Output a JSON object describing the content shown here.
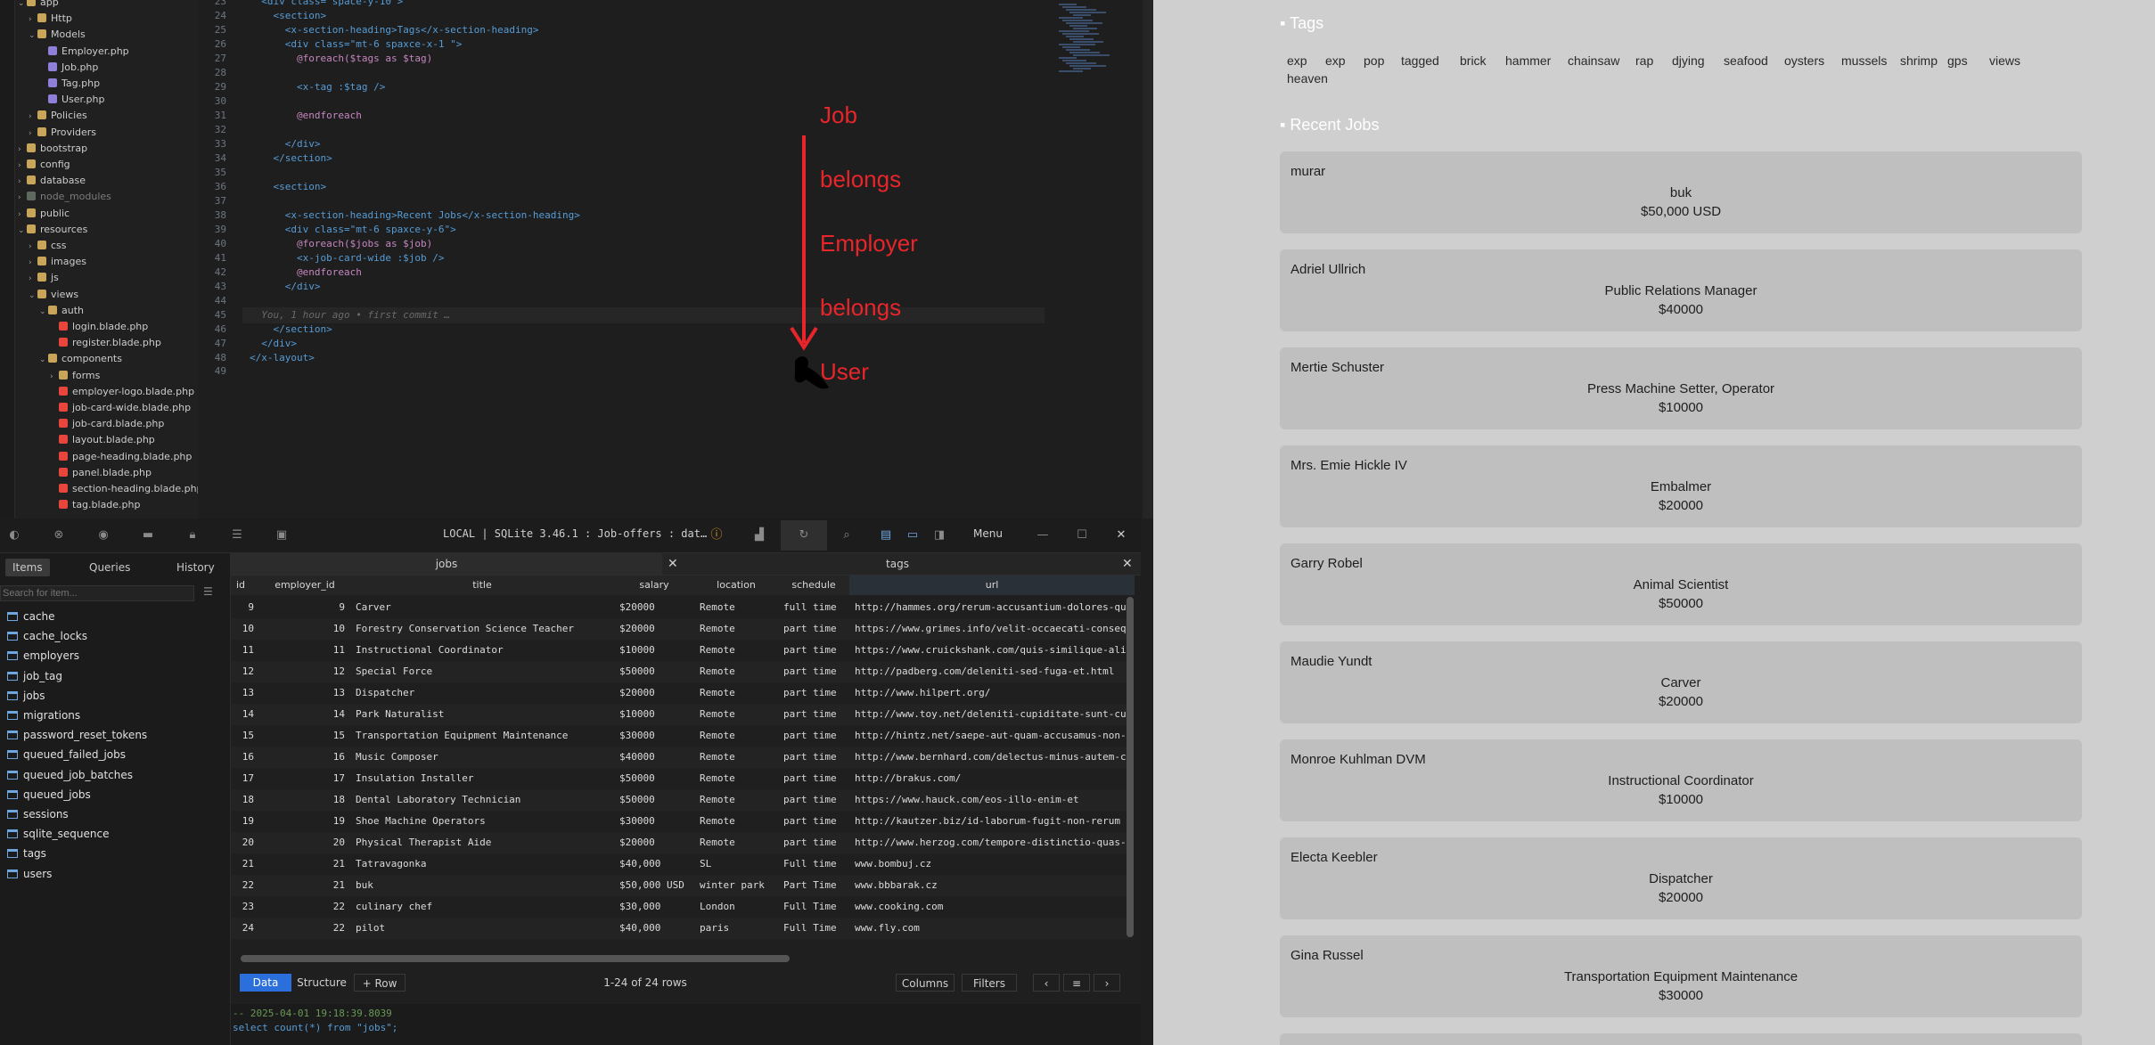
{
  "explorer": {
    "items": [
      {
        "label": "app",
        "depth": 1,
        "kind": "folder-open"
      },
      {
        "label": "Http",
        "depth": 2,
        "kind": "folder"
      },
      {
        "label": "Models",
        "depth": 2,
        "kind": "folder-open"
      },
      {
        "label": "Employer.php",
        "depth": 3,
        "kind": "php"
      },
      {
        "label": "Job.php",
        "depth": 3,
        "kind": "php"
      },
      {
        "label": "Tag.php",
        "depth": 3,
        "kind": "php"
      },
      {
        "label": "User.php",
        "depth": 3,
        "kind": "php"
      },
      {
        "label": "Policies",
        "depth": 2,
        "kind": "folder"
      },
      {
        "label": "Providers",
        "depth": 2,
        "kind": "folder"
      },
      {
        "label": "bootstrap",
        "depth": 1,
        "kind": "folder"
      },
      {
        "label": "config",
        "depth": 1,
        "kind": "folder"
      },
      {
        "label": "database",
        "depth": 1,
        "kind": "folder"
      },
      {
        "label": "node_modules",
        "depth": 1,
        "kind": "folder-muted"
      },
      {
        "label": "public",
        "depth": 1,
        "kind": "folder"
      },
      {
        "label": "resources",
        "depth": 1,
        "kind": "folder-open"
      },
      {
        "label": "css",
        "depth": 2,
        "kind": "folder"
      },
      {
        "label": "images",
        "depth": 2,
        "kind": "folder"
      },
      {
        "label": "js",
        "depth": 2,
        "kind": "folder"
      },
      {
        "label": "views",
        "depth": 2,
        "kind": "folder-open"
      },
      {
        "label": "auth",
        "depth": 3,
        "kind": "folder-open"
      },
      {
        "label": "login.blade.php",
        "depth": 4,
        "kind": "blade"
      },
      {
        "label": "register.blade.php",
        "depth": 4,
        "kind": "blade"
      },
      {
        "label": "components",
        "depth": 3,
        "kind": "folder-open"
      },
      {
        "label": "forms",
        "depth": 4,
        "kind": "folder"
      },
      {
        "label": "employer-logo.blade.php",
        "depth": 4,
        "kind": "blade"
      },
      {
        "label": "job-card-wide.blade.php",
        "depth": 4,
        "kind": "blade"
      },
      {
        "label": "job-card.blade.php",
        "depth": 4,
        "kind": "blade"
      },
      {
        "label": "layout.blade.php",
        "depth": 4,
        "kind": "blade"
      },
      {
        "label": "page-heading.blade.php",
        "depth": 4,
        "kind": "blade"
      },
      {
        "label": "panel.blade.php",
        "depth": 4,
        "kind": "blade"
      },
      {
        "label": "section-heading.blade.php",
        "depth": 4,
        "kind": "blade"
      },
      {
        "label": "tag.blade.php",
        "depth": 4,
        "kind": "blade"
      }
    ]
  },
  "editor": {
    "lines": [
      {
        "n": "23",
        "code": "  <div class=\"space-y-10\">"
      },
      {
        "n": "24",
        "code": "    <section>"
      },
      {
        "n": "25",
        "code": "      <x-section-heading>Tags</x-section-heading>"
      },
      {
        "n": "26",
        "code": "      <div class=\"mt-6 spaxce-x-1 \">"
      },
      {
        "n": "27",
        "code": "        @foreach($tags as $tag)"
      },
      {
        "n": "28",
        "code": ""
      },
      {
        "n": "29",
        "code": "        <x-tag :$tag />"
      },
      {
        "n": "30",
        "code": ""
      },
      {
        "n": "31",
        "code": "        @endforeach"
      },
      {
        "n": "32",
        "code": ""
      },
      {
        "n": "33",
        "code": "      </div>"
      },
      {
        "n": "34",
        "code": "    </section>"
      },
      {
        "n": "35",
        "code": ""
      },
      {
        "n": "36",
        "code": "    <section>"
      },
      {
        "n": "37",
        "code": ""
      },
      {
        "n": "38",
        "code": "      <x-section-heading>Recent Jobs</x-section-heading>"
      },
      {
        "n": "39",
        "code": "      <div class=\"mt-6 spaxce-y-6\">"
      },
      {
        "n": "40",
        "code": "        @foreach($jobs as $job)"
      },
      {
        "n": "41",
        "code": "        <x-job-card-wide :$job />"
      },
      {
        "n": "42",
        "code": "        @endforeach"
      },
      {
        "n": "43",
        "code": "      </div>"
      },
      {
        "n": "44",
        "code": ""
      },
      {
        "n": "45",
        "code": "  You, 1 hour ago • first commit …"
      },
      {
        "n": "46",
        "code": "    </section>"
      },
      {
        "n": "47",
        "code": "  </div>"
      },
      {
        "n": "48",
        "code": "</x-layout>"
      },
      {
        "n": "49",
        "code": ""
      }
    ]
  },
  "annotation": {
    "words": [
      "Job",
      "belongs",
      "Employer",
      "belongs",
      "User"
    ],
    "color": "#e8252a"
  },
  "db": {
    "connection": "LOCAL | SQLite 3.46.1 : Job-offers : dat…",
    "menu_label": "Menu",
    "sidebar_tabs": [
      "Items",
      "Queries",
      "History"
    ],
    "search_placeholder": "Search for item...",
    "tables": [
      "cache",
      "cache_locks",
      "employers",
      "job_tag",
      "jobs",
      "migrations",
      "password_reset_tokens",
      "queued_failed_jobs",
      "queued_job_batches",
      "queued_jobs",
      "sessions",
      "sqlite_sequence",
      "tags",
      "users"
    ],
    "open_tabs": [
      "jobs",
      "tags"
    ],
    "columns": [
      "id",
      "employer_id",
      "title",
      "salary",
      "location",
      "schedule",
      "url"
    ],
    "rows": [
      [
        "9",
        "9",
        "Carver",
        "$20000",
        "Remote",
        "full time",
        "http://hammes.org/rerum-accusantium-dolores-qu"
      ],
      [
        "10",
        "10",
        "Forestry Conservation Science Teacher",
        "$20000",
        "Remote",
        "part time",
        "https://www.grimes.info/velit-occaecati-conseq"
      ],
      [
        "11",
        "11",
        "Instructional Coordinator",
        "$10000",
        "Remote",
        "part time",
        "https://www.cruickshank.com/quis-similique-ali"
      ],
      [
        "12",
        "12",
        "Special Force",
        "$50000",
        "Remote",
        "part time",
        "http://padberg.com/deleniti-sed-fuga-et.html"
      ],
      [
        "13",
        "13",
        "Dispatcher",
        "$20000",
        "Remote",
        "part time",
        "http://www.hilpert.org/"
      ],
      [
        "14",
        "14",
        "Park Naturalist",
        "$10000",
        "Remote",
        "part time",
        "http://www.toy.net/deleniti-cupiditate-sunt-cu"
      ],
      [
        "15",
        "15",
        "Transportation Equipment Maintenance",
        "$30000",
        "Remote",
        "part time",
        "http://hintz.net/saepe-aut-quam-accusamus-non-"
      ],
      [
        "16",
        "16",
        "Music Composer",
        "$40000",
        "Remote",
        "part time",
        "http://www.bernhard.com/delectus-minus-autem-c"
      ],
      [
        "17",
        "17",
        "Insulation Installer",
        "$50000",
        "Remote",
        "part time",
        "http://brakus.com/"
      ],
      [
        "18",
        "18",
        "Dental Laboratory Technician",
        "$50000",
        "Remote",
        "part time",
        "https://www.hauck.com/eos-illo-enim-et"
      ],
      [
        "19",
        "19",
        "Shoe Machine Operators",
        "$30000",
        "Remote",
        "part time",
        "http://kautzer.biz/id-laborum-fugit-non-rerum"
      ],
      [
        "20",
        "20",
        "Physical Therapist Aide",
        "$20000",
        "Remote",
        "part time",
        "http://www.herzog.com/tempore-distinctio-quas-"
      ],
      [
        "21",
        "21",
        "Tatravagonka",
        "$40,000",
        "SL",
        "Full time",
        "www.bombuj.cz"
      ],
      [
        "22",
        "21",
        "buk",
        "$50,000 USD",
        "winter park",
        "Part Time",
        "www.bbbarak.cz"
      ],
      [
        "23",
        "22",
        "culinary chef",
        "$30,000",
        "London",
        "Full Time",
        "www.cooking.com"
      ],
      [
        "24",
        "22",
        "pilot",
        "$40,000",
        "paris",
        "Full Time",
        "www.fly.com"
      ]
    ],
    "bottom_tabs": [
      "Data",
      "Structure",
      "+ Row"
    ],
    "row_count": "1-24 of 24 rows",
    "columns_button": "Columns",
    "filters_button": "Filters",
    "query_log": [
      "-- 2025-04-01 19:18:39.8039",
      "select count(*) from \"jobs\";"
    ]
  },
  "web": {
    "tags_heading": "Tags",
    "tags": [
      "exp",
      "exp",
      "pop",
      "tagged",
      "brick",
      "hammer",
      "chainsaw",
      "rap",
      "djying",
      "seafood",
      "oysters",
      "mussels",
      "shrimp",
      "gps",
      "views",
      "heaven"
    ],
    "jobs_heading": "Recent Jobs",
    "jobs": [
      {
        "employer": "murar",
        "title": "buk",
        "salary": "$50,000 USD"
      },
      {
        "employer": "Adriel Ullrich",
        "title": "Public Relations Manager",
        "salary": "$40000"
      },
      {
        "employer": "Mertie Schuster",
        "title": "Press Machine Setter, Operator",
        "salary": "$10000"
      },
      {
        "employer": "Mrs. Emie Hickle IV",
        "title": "Embalmer",
        "salary": "$20000"
      },
      {
        "employer": "Garry Robel",
        "title": "Animal Scientist",
        "salary": "$50000"
      },
      {
        "employer": "Maudie Yundt",
        "title": "Carver",
        "salary": "$20000"
      },
      {
        "employer": "Monroe Kuhlman DVM",
        "title": "Instructional Coordinator",
        "salary": "$10000"
      },
      {
        "employer": "Electa Keebler",
        "title": "Dispatcher",
        "salary": "$20000"
      },
      {
        "employer": "Gina Russel",
        "title": "Transportation Equipment Maintenance",
        "salary": "$30000"
      }
    ]
  }
}
